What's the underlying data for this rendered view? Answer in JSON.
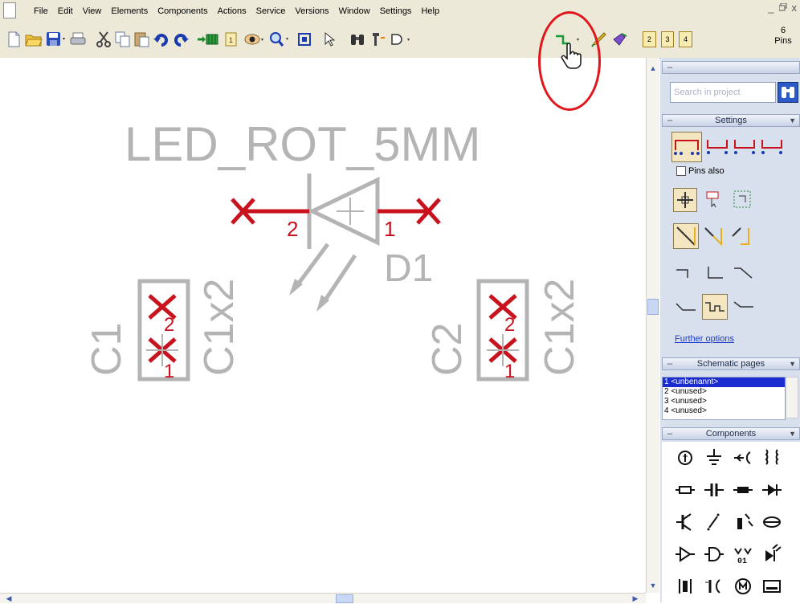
{
  "menu": [
    "File",
    "Edit",
    "View",
    "Elements",
    "Components",
    "Actions",
    "Service",
    "Versions",
    "Window",
    "Settings",
    "Help"
  ],
  "window_controls": [
    "_",
    "   ",
    "x"
  ],
  "toolbar": {
    "pins_count": "6",
    "pins_label": "Pins",
    "layer_buttons": [
      "2",
      "3",
      "4"
    ]
  },
  "schematic": {
    "led_value": "LED_ROT_5MM",
    "led_ref": "D1",
    "led_pin_left": "2",
    "led_pin_right": "1",
    "conn1_ref": "C1",
    "conn1_value": "C1x2",
    "conn2_ref": "C2",
    "conn2_value": "C1x2",
    "conn_pin_top": "2",
    "conn_pin_bottom": "1"
  },
  "panel": {
    "search_placeholder": "Search in project",
    "settings_title": "Settings",
    "pins_also_label": "Pins also",
    "further_options": "Further options",
    "schematic_pages_title": "Schematic pages",
    "pages": [
      "1 <unbenannt>",
      "2 <unused>",
      "3 <unused>",
      "4 <unused>"
    ],
    "components_title": "Components"
  },
  "colors": {
    "chrome": "#ece9d8",
    "panel": "#d8e0ee",
    "pin_red": "#c8121e",
    "symbol_gray": "#b4b4b4",
    "selection_blue": "#1a2cd0",
    "annotation_red": "#e0161b"
  }
}
